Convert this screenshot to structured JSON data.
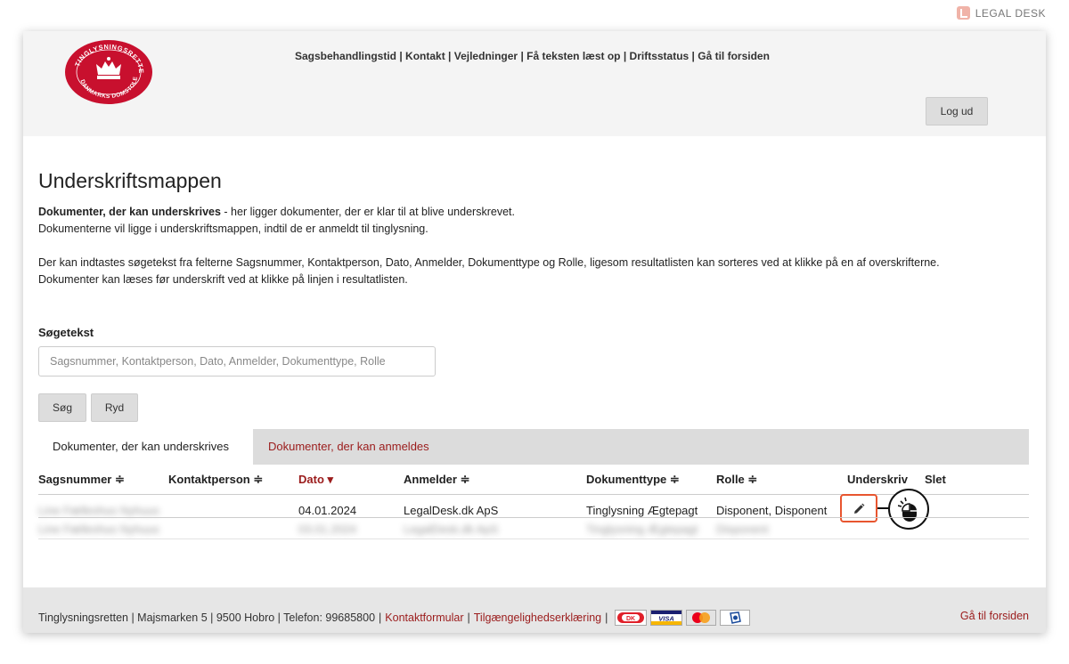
{
  "brand": {
    "name": "LEGAL DESK"
  },
  "logo": {
    "top_text": "TINGLYSNINGSRETTEN",
    "bottom_text": "DANMARKS DOMSTOLE"
  },
  "topnav": {
    "items": [
      "Sagsbehandlingstid",
      "Kontakt",
      "Vejledninger",
      "Få teksten læst op",
      "Driftsstatus",
      "Gå til forsiden"
    ],
    "separator": " | "
  },
  "header": {
    "logout_label": "Log ud"
  },
  "page": {
    "title": "Underskriftsmappen",
    "intro_bold": "Dokumenter, der kan underskrives",
    "intro_line1_rest": " - her ligger dokumenter, der er klar til at blive underskrevet.",
    "intro_line2": "Dokumenterne vil ligge i underskriftsmappen, indtil de er anmeldt til tinglysning.",
    "intro_line3": "Der kan indtastes søgetekst fra felterne Sagsnummer, Kontaktperson, Dato, Anmelder, Dokumenttype og Rolle, ligesom resultatlisten kan sorteres ved at klikke på en af overskrifterne.",
    "intro_line4": "Dokumenter kan læses før underskrift ved at klikke på linjen i resultatlisten."
  },
  "search": {
    "label": "Søgetekst",
    "placeholder": "Sagsnummer, Kontaktperson, Dato, Anmelder, Dokumenttype, Rolle",
    "value": "",
    "search_button": "Søg",
    "clear_button": "Ryd"
  },
  "tabs": [
    {
      "label": "Dokumenter, der kan underskrives",
      "active": true
    },
    {
      "label": "Dokumenter, der kan anmeldes",
      "active": false
    }
  ],
  "table": {
    "columns": [
      "Sagsnummer ≑",
      "Kontaktperson ≑",
      "Dato ▾",
      "Anmelder ≑",
      "Dokumenttype ≑",
      "Rolle ≑",
      "Underskriv",
      "Slet"
    ],
    "rows": [
      {
        "sagsnummer": "Line Fælleshus Nyhuus",
        "kontaktperson": "",
        "dato": "04.01.2024",
        "anmelder": "LegalDesk.dk ApS",
        "dokumenttype": "Tinglysning Ægtepagt",
        "rolle": "Disponent, Disponent"
      },
      {
        "sagsnummer": "Line Fælleshus Nyhuus",
        "kontaktperson": "",
        "dato": "03.01.2024",
        "anmelder": "LegalDesk.dk ApS",
        "dokumenttype": "Tinglysning Ægtepagt",
        "rolle": "Disponent"
      }
    ]
  },
  "footer": {
    "address": "Tinglysningsretten | Majsmarken 5 | 9500 Hobro | Telefon: 99685800",
    "contact_link": "Kontaktformular",
    "accessibility_link": "Tilgængelighedserklæring",
    "cards": {
      "dk": "DK",
      "visa": "VISA"
    },
    "home_link": "Gå til forsiden"
  },
  "colors": {
    "accent": "#9b1c1c",
    "highlight": "#e8552f",
    "header_bg": "#f4f4f4",
    "footer_bg": "#e6e6e6"
  }
}
